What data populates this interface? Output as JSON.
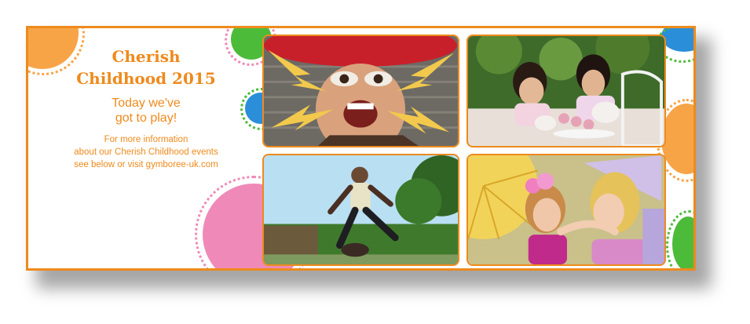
{
  "banner": {
    "title_line1": "Cherish",
    "title_line2": "Childhood 2015",
    "tagline_line1": "Today we've",
    "tagline_line2": "got to play!",
    "info_line1": "For more information",
    "info_line2": "about our Cherish Childhood events",
    "info_line3": "see below or visit gymboree-uk.com"
  },
  "colors": {
    "accent": "#ee8a1c",
    "pink": "#ef8ab8",
    "green": "#4dbb3a",
    "blue": "#2a8fd8",
    "orange_dot": "#f7a447"
  }
}
